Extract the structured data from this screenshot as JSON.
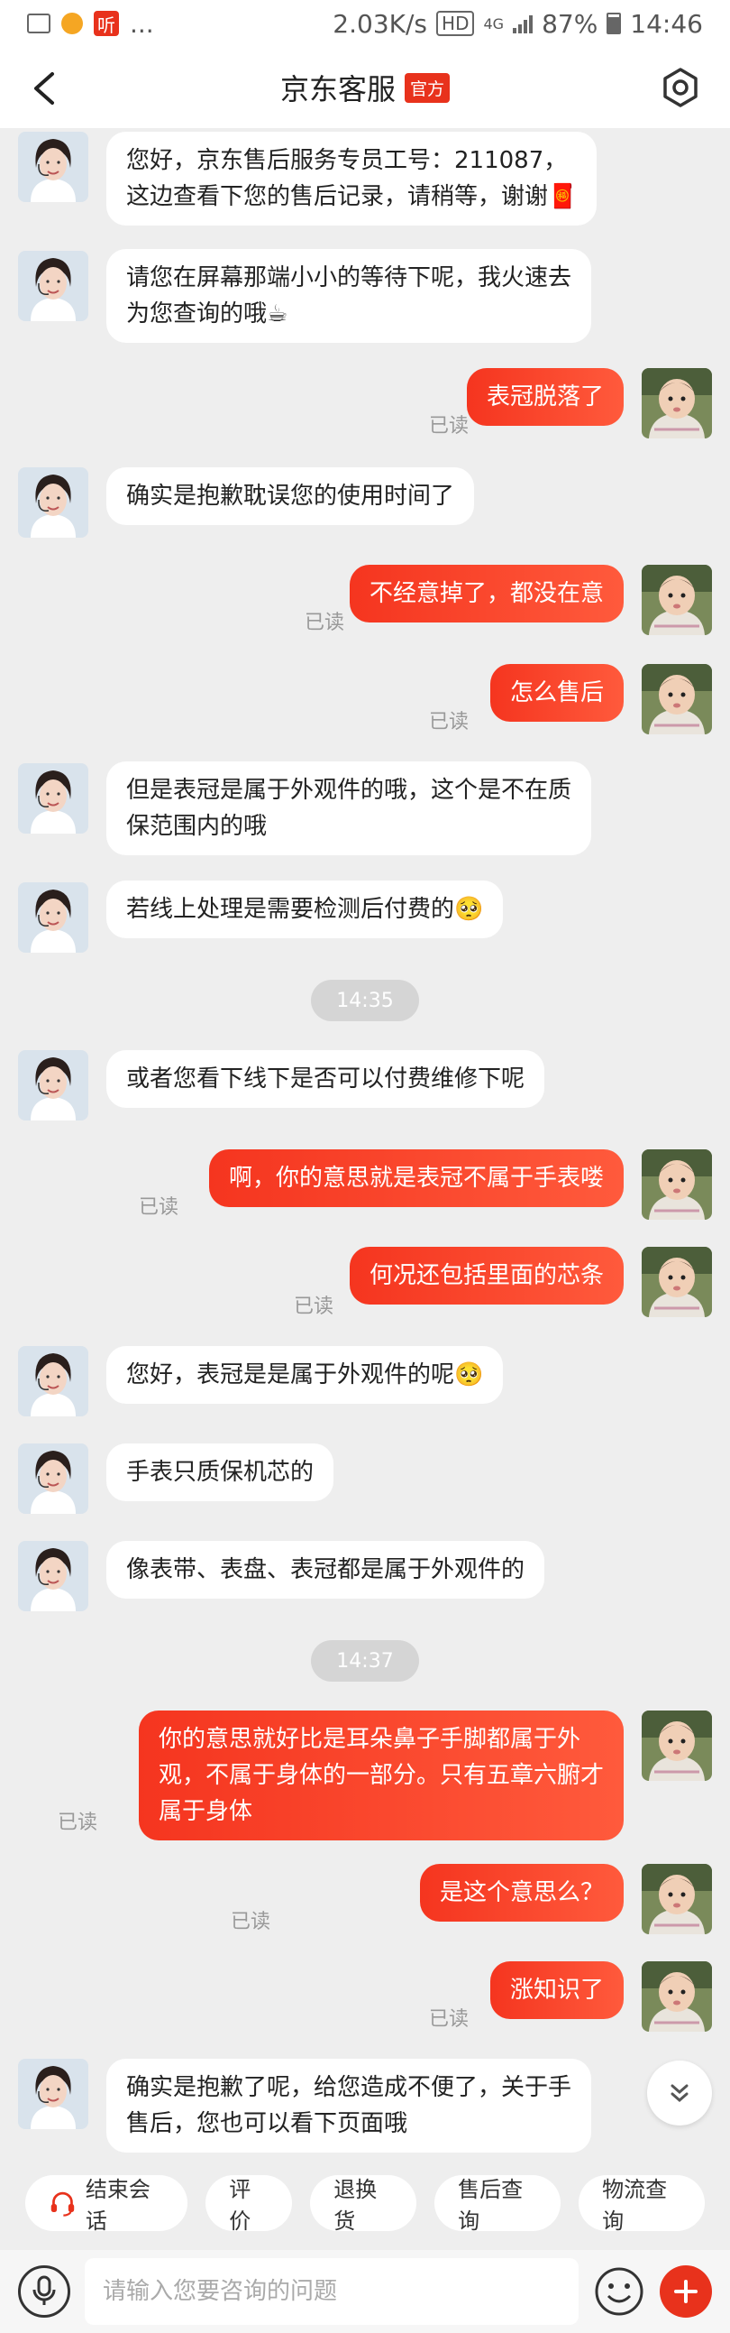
{
  "status_bar": {
    "network_speed": "2.03K/s",
    "network_type": "4G",
    "battery": "87%",
    "time": "14:46",
    "app_badge": "听",
    "dots": "...",
    "hd": "HD"
  },
  "header": {
    "title": "京东客服",
    "badge": "官方"
  },
  "messages": [
    {
      "from": "agent",
      "text": "您好，京东售后服务专员工号：211087，\n这边查看下您的售后记录，请稍等，谢谢🧧"
    },
    {
      "from": "agent",
      "text": "请您在屏幕那端小小的等待下呢，我火速去\n为您查询的哦☕"
    },
    {
      "from": "user",
      "text": "表冠脱落了",
      "read": "已读"
    },
    {
      "from": "agent",
      "text": "确实是抱歉耽误您的使用时间了"
    },
    {
      "from": "user",
      "text": "不经意掉了，都没在意",
      "read": "已读"
    },
    {
      "from": "user",
      "text": "怎么售后",
      "read": "已读"
    },
    {
      "from": "agent",
      "text": "但是表冠是属于外观件的哦，这个是不在质\n保范围内的哦"
    },
    {
      "from": "agent",
      "text": "若线上处理是需要检测后付费的🥺"
    },
    {
      "from": "time",
      "text": "14:35"
    },
    {
      "from": "agent",
      "text": "或者您看下线下是否可以付费维修下呢"
    },
    {
      "from": "user",
      "text": "啊，你的意思就是表冠不属于手表喽",
      "read": "已读"
    },
    {
      "from": "user",
      "text": "何况还包括里面的芯条",
      "read": "已读"
    },
    {
      "from": "agent",
      "text": "您好，表冠是是属于外观件的呢🥺"
    },
    {
      "from": "agent",
      "text": "手表只质保机芯的"
    },
    {
      "from": "agent",
      "text": "像表带、表盘、表冠都是属于外观件的"
    },
    {
      "from": "time",
      "text": "14:37"
    },
    {
      "from": "user",
      "text": "你的意思就好比是耳朵鼻子手脚都属于外\n观，不属于身体的一部分。只有五章六腑才\n属于身体",
      "read": "已读"
    },
    {
      "from": "user",
      "text": "是这个意思么？",
      "read": "已读"
    },
    {
      "from": "user",
      "text": "涨知识了",
      "read": "已读"
    },
    {
      "from": "agent",
      "text": "确实是抱歉了呢，给您造成不便了，关于手\n售后，您也可以看下页面哦"
    }
  ],
  "quick_actions": [
    "结束会话",
    "评价",
    "退换货",
    "售后查询",
    "物流查询"
  ],
  "input": {
    "placeholder": "请输入您要咨询的问题"
  },
  "colors": {
    "accent": "#e8321c",
    "user_bubble": "#f5351f",
    "background": "#eeeeee"
  }
}
